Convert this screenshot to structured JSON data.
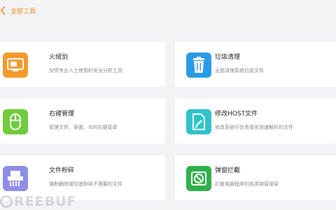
{
  "topbar": {
    "breadcrumb": "全部工具"
  },
  "colors": {
    "accent": "#f08a24"
  },
  "tools": [
    {
      "title": "火绒剑",
      "desc": "仅供专业人士使用的安全分析工具",
      "icon": "monitor-icon",
      "color": "#f39a2c"
    },
    {
      "title": "垃圾清理",
      "desc": "全面清理系统垃圾文件",
      "icon": "trash-icon",
      "color": "#2b9be8"
    },
    {
      "title": "右键管理",
      "desc": "管理文件、桌面、IE的右键菜单",
      "icon": "mouse-icon",
      "color": "#6fcc3a"
    },
    {
      "title": "修改HOST文件",
      "desc": "修改系统中负责域名快速解析的文件",
      "icon": "edit-document-icon",
      "color": "#2ec3c8"
    },
    {
      "title": "文件粉碎",
      "desc": "强制删除或彻底粉碎不需要的文件",
      "icon": "shredder-icon",
      "color": "#8e8ee6"
    },
    {
      "title": "弹窗拦截",
      "desc": "拦截电脑程序的各类弹窗弹窗",
      "icon": "popup-block-icon",
      "color": "#2eb04a"
    }
  ],
  "watermark": "REEBUF"
}
